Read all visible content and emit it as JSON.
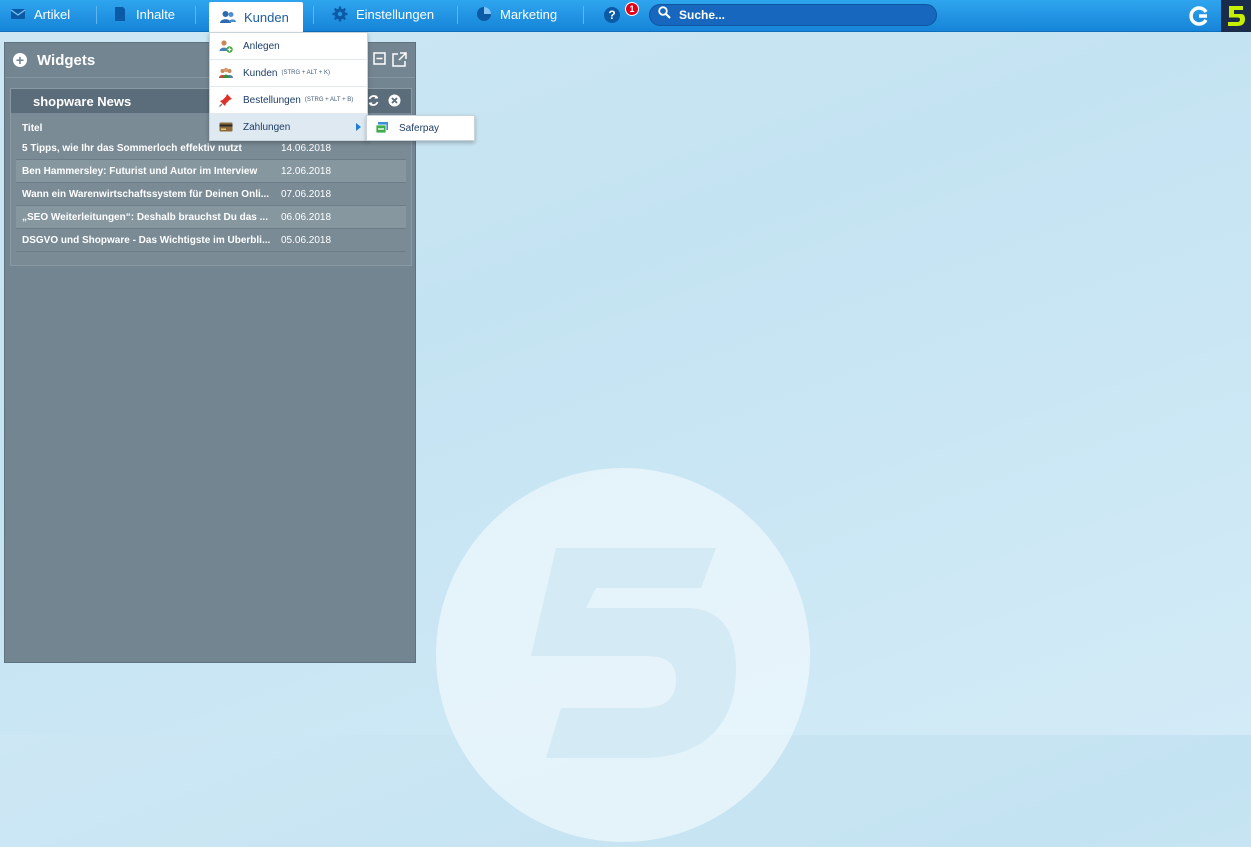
{
  "nav": {
    "items": [
      {
        "label": "Artikel",
        "icon": "envelope-icon"
      },
      {
        "label": "Inhalte",
        "icon": "document-icon"
      },
      {
        "label": "Kunden",
        "icon": "users-icon"
      },
      {
        "label": "Einstellungen",
        "icon": "gear-icon"
      },
      {
        "label": "Marketing",
        "icon": "pie-chart-icon"
      }
    ],
    "help_label": "?",
    "notification_count": "1",
    "search_placeholder": "Suche..."
  },
  "dropdown": {
    "items": [
      {
        "label": "Anlegen",
        "shortcut": ""
      },
      {
        "label": "Kunden",
        "shortcut": "(STRG + ALT + K)"
      },
      {
        "label": "Bestellungen",
        "shortcut": "(STRG + ALT + B)"
      },
      {
        "label": "Zahlungen",
        "shortcut": ""
      }
    ],
    "submenu": {
      "label": "Saferpay"
    }
  },
  "widgets": {
    "title": "Widgets",
    "news": {
      "title": "shopware News",
      "column_title": "Titel",
      "rows": [
        {
          "title": "5 Tipps, wie Ihr das Sommerloch effektiv nutzt",
          "date": "14.06.2018"
        },
        {
          "title": "Ben Hammersley: Futurist und Autor im Interview",
          "date": "12.06.2018"
        },
        {
          "title": "Wann ein Warenwirtschaftssystem für Deinen Onli...",
          "date": "07.06.2018"
        },
        {
          "title": "„SEO Weiterleitungen“: Deshalb brauchst Du das ...",
          "date": "06.06.2018"
        },
        {
          "title": "DSGVO und Shopware - Das Wichtigste im Überbli...",
          "date": "05.06.2018"
        }
      ]
    }
  },
  "colors": {
    "topbar": "#1b8ee3",
    "panel": "#738591",
    "accent": "#1f7ed3"
  }
}
